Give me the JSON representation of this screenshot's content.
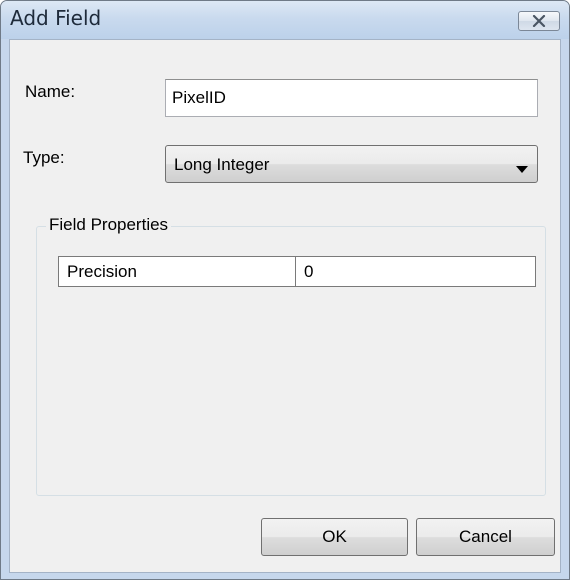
{
  "window": {
    "title": "Add Field",
    "close_icon": "close-x-icon"
  },
  "form": {
    "name_label": "Name:",
    "name_value": "PixelID",
    "type_label": "Type:",
    "type_value": "Long Integer",
    "dropdown_icon": "dropdown-arrow-icon"
  },
  "field_properties": {
    "legend": "Field Properties",
    "rows": [
      {
        "property": "Precision",
        "value": "0"
      }
    ]
  },
  "buttons": {
    "ok_label": "OK",
    "cancel_label": "Cancel"
  },
  "colors": {
    "titlebar": "#c9daee",
    "client_background": "#f0f0f0"
  }
}
